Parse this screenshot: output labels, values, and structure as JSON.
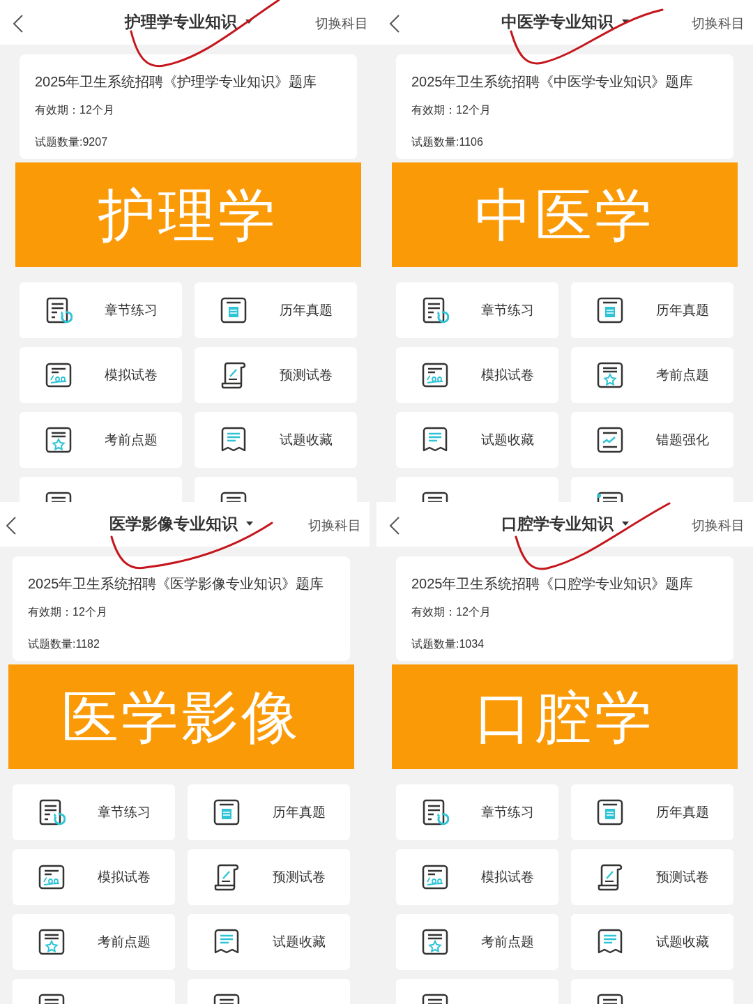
{
  "panels": [
    {
      "header": {
        "title": "护理学专业知识",
        "switch_label": "切换科目"
      },
      "card": {
        "title": "2025年卫生系统招聘《护理学专业知识》题库",
        "validity": "有效期：12个月",
        "count": "试题数量:9207"
      },
      "banner": "护理学",
      "tiles": [
        {
          "kind": "chapter",
          "label": "章节练习"
        },
        {
          "kind": "exam",
          "label": "历年真题"
        },
        {
          "kind": "mock",
          "label": "模拟试卷"
        },
        {
          "kind": "forecast",
          "label": "预测试卷"
        },
        {
          "kind": "star",
          "label": "考前点题"
        },
        {
          "kind": "bookmark",
          "label": "试题收藏"
        },
        {
          "kind": "list"
        },
        {
          "kind": "list"
        }
      ]
    },
    {
      "header": {
        "title": "中医学专业知识",
        "switch_label": "切换科目"
      },
      "card": {
        "title": "2025年卫生系统招聘《中医学专业知识》题库",
        "validity": "有效期：12个月",
        "count": "试题数量:1106"
      },
      "banner": "中医学",
      "tiles": [
        {
          "kind": "chapter",
          "label": "章节练习"
        },
        {
          "kind": "exam",
          "label": "历年真题"
        },
        {
          "kind": "mock",
          "label": "模拟试卷"
        },
        {
          "kind": "star",
          "label": "考前点题"
        },
        {
          "kind": "bookmark",
          "label": "试题收藏"
        },
        {
          "kind": "chart",
          "label": "错题强化"
        },
        {
          "kind": "list"
        },
        {
          "kind": "note"
        }
      ]
    },
    {
      "header": {
        "title": "医学影像专业知识",
        "switch_label": "切换科目"
      },
      "card": {
        "title": "2025年卫生系统招聘《医学影像专业知识》题库",
        "validity": "有效期：12个月",
        "count": "试题数量:1182"
      },
      "banner": "医学影像",
      "tiles": [
        {
          "kind": "chapter",
          "label": "章节练习"
        },
        {
          "kind": "exam",
          "label": "历年真题"
        },
        {
          "kind": "mock",
          "label": "模拟试卷"
        },
        {
          "kind": "forecast",
          "label": "预测试卷"
        },
        {
          "kind": "star",
          "label": "考前点题"
        },
        {
          "kind": "bookmark",
          "label": "试题收藏"
        },
        {
          "kind": "list"
        },
        {
          "kind": "list"
        }
      ]
    },
    {
      "header": {
        "title": "口腔学专业知识",
        "switch_label": "切换科目"
      },
      "card": {
        "title": "2025年卫生系统招聘《口腔学专业知识》题库",
        "validity": "有效期：12个月",
        "count": "试题数量:1034"
      },
      "banner": "口腔学",
      "tiles": [
        {
          "kind": "chapter",
          "label": "章节练习"
        },
        {
          "kind": "exam",
          "label": "历年真题"
        },
        {
          "kind": "mock",
          "label": "模拟试卷"
        },
        {
          "kind": "forecast",
          "label": "预测试卷"
        },
        {
          "kind": "star",
          "label": "考前点题"
        },
        {
          "kind": "bookmark",
          "label": "试题收藏"
        },
        {
          "kind": "list"
        },
        {
          "kind": "list"
        }
      ]
    }
  ]
}
